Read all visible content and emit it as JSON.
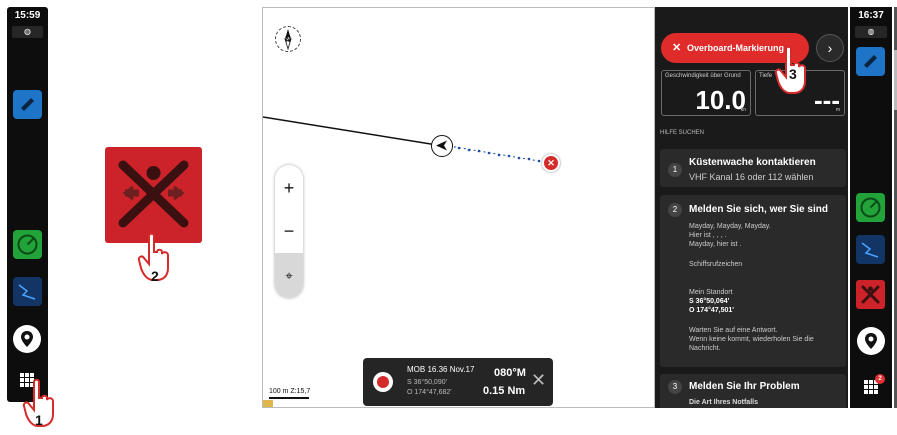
{
  "left_phone": {
    "time": "15:59",
    "status": "◍"
  },
  "steps": {
    "one": "1",
    "two": "2",
    "three": "3"
  },
  "map": {
    "compass_label": "N",
    "zoom_in": "+",
    "zoom_out": "−",
    "locate_icon": "⌖",
    "scale": "100 m Z:15,7"
  },
  "mob_card": {
    "title": "MOB 16.36 Nov.17",
    "lat": "S 36°50,090'",
    "lon": "O 174°47,682'",
    "bearing": "080°M",
    "distance": "0.15 Nm",
    "close": "✕"
  },
  "panel": {
    "overboard_label": "Overboard-Markierung",
    "overboard_icon": "✕",
    "next": "›",
    "sog_label": "Geschwindigkeit über Grund",
    "sog_value": "10.0",
    "sog_unit": "kn",
    "depth_label": "Tiefe",
    "depth_value": "---",
    "depth_unit": "m",
    "section": "HILFE SUCHEN",
    "cards": [
      {
        "num": "1",
        "title": "Küstenwache kontaktieren",
        "sub": "VHF Kanal 16 oder 112 wählen"
      },
      {
        "num": "2",
        "title": "Melden Sie sich, wer Sie sind",
        "line1": "Mayday, Mayday, Mayday.",
        "line2": "Hier ist , , , .",
        "line3": "Mayday, hier ist .",
        "line4": "Schiffsrufzeichen",
        "line5": "Mein Standort",
        "pos_lat": "S 36°50,064'",
        "pos_lon": "O 174°47,501'",
        "line6": "Warten Sie auf eine Antwort.",
        "line7": "Wenn keine kommt, wiederholen Sie die",
        "line8": "Nachricht."
      },
      {
        "num": "3",
        "title": "Melden Sie Ihr Problem",
        "sub": "Die Art Ihres Notfalls"
      }
    ]
  },
  "right_phone": {
    "time": "16:37",
    "status": "◍",
    "badge": "2"
  },
  "colors": {
    "accent_red": "#e02b2b",
    "mob_red": "#cc2229",
    "panel_bg": "#1a1a1a",
    "green_app": "#22a33a",
    "blue_app": "#1e74c6"
  }
}
